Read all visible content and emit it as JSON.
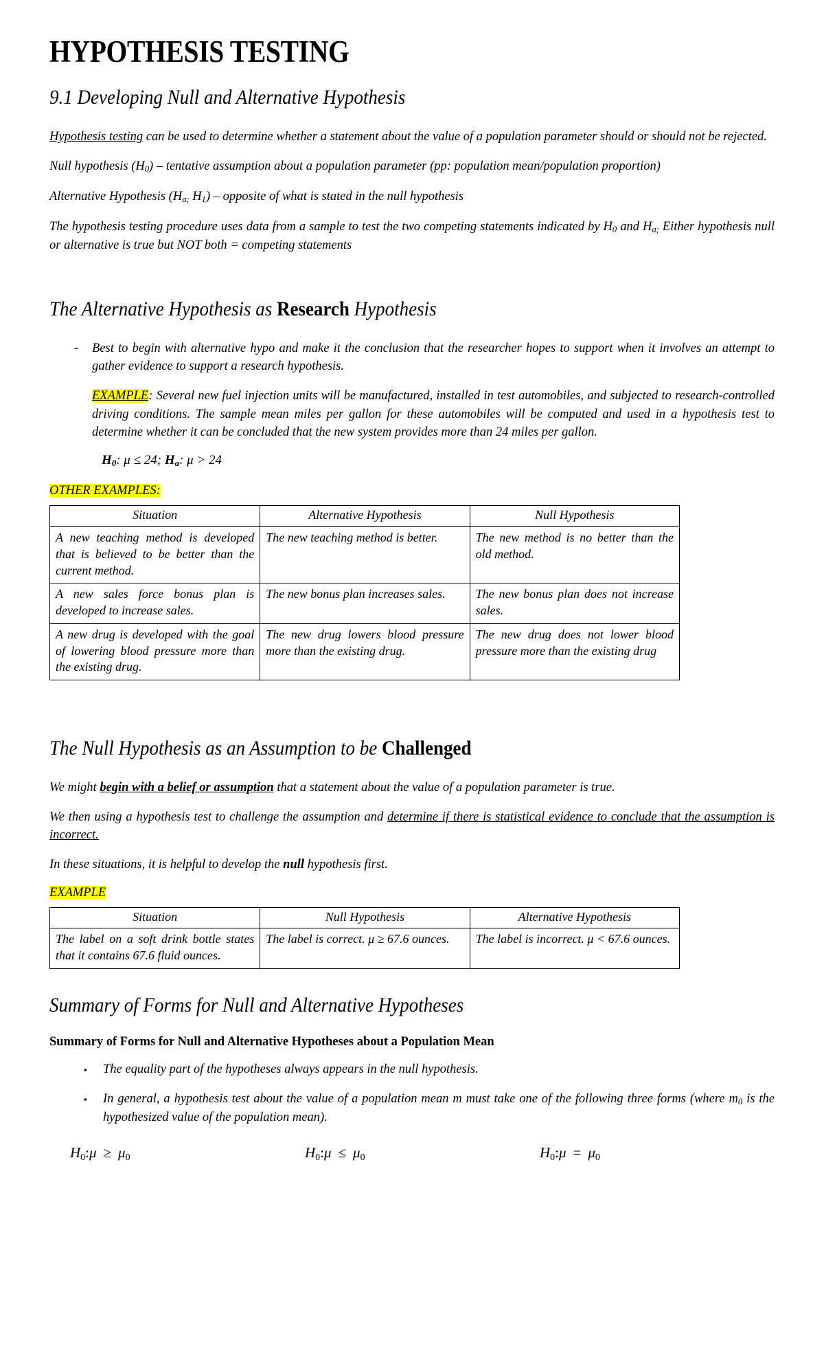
{
  "document": {
    "title": "HYPOTHESIS TESTING",
    "section_heading": "9.1 Developing Null and Alternative Hypothesis",
    "intro": {
      "p1_lead": "Hypothesis testing",
      "p1_rest": " can be used to determine whether a statement about the value of a population parameter should or should not be rejected.",
      "p2_a": "Null hypothesis (H",
      "p2_sub": "0",
      "p2_b": ") – tentative assumption about a population parameter (pp: population mean/population proportion)",
      "p3_a": "Alternative Hypothesis (H",
      "p3_sub1": "a;",
      "p3_mid": " H",
      "p3_sub2": "1",
      "p3_b": ") – opposite of what is stated in the null hypothesis",
      "p4_a": "The hypothesis testing procedure uses data from a sample to test the two competing statements indicated by H",
      "p4_sub1": "0",
      "p4_mid": " and H",
      "p4_sub2": "a;",
      "p4_b": " Either hypothesis null or alternative is true but NOT both = competing statements"
    },
    "research_section": {
      "heading_pre": "The Alternative Hypothesis as ",
      "heading_bold": "Research",
      "heading_post": " Hypothesis",
      "dash_marker": "-",
      "bullet": "Best to begin with alternative hypo and make it the conclusion that the researcher hopes to support when it involves an attempt to gather evidence to support a research hypothesis.",
      "example_label": "EXAMPLE",
      "example_text": ": Several new fuel injection units will be manufactured, installed in test automobiles, and subjected to research-controlled driving conditions. The sample mean miles per gallon for these automobiles will be computed and used in a hypothesis test to determine whether it can be concluded that the new system provides more than 24 miles per gallon.",
      "formula_h0_label": "H",
      "formula_h0_sub": "0",
      "formula_h0_body": ": μ ≤ 24; ",
      "formula_ha_label": "H",
      "formula_ha_sub": "a",
      "formula_ha_body": ": μ > 24",
      "other_examples_label": "OTHER EXAMPLES:"
    },
    "table1": {
      "headers": [
        "Situation",
        "Alternative Hypothesis",
        "Null Hypothesis"
      ],
      "rows": [
        [
          "A new teaching method is developed that is believed to be better than the current method.",
          "The new teaching method is better.",
          "The new method is no better than the old method."
        ],
        [
          "A new sales force bonus plan is developed to increase sales.",
          "The new bonus plan increases sales.",
          "The new bonus plan does not increase sales."
        ],
        [
          "A new drug is developed with the goal of lowering blood pressure more than the existing drug.",
          "The new drug lowers blood pressure more than the existing drug.",
          "The new drug does not lower blood pressure more than the existing drug"
        ]
      ]
    },
    "challenged_section": {
      "heading_pre": "The Null Hypothesis as an Assumption to be ",
      "heading_bold": "Challenged",
      "p1_a": "We might ",
      "p1_u": "begin with a belief or assumption",
      "p1_b": " that a statement about the value of a population parameter is true.",
      "p2_a": "We then using a hypothesis test to challenge the assumption and ",
      "p2_u": "determine if there is statistical evidence to conclude that the assumption is incorrect.",
      "p3_a": "In these situations, it is helpful to develop the ",
      "p3_bold": "null",
      "p3_b": " hypothesis first.",
      "example_label": "EXAMPLE"
    },
    "table2": {
      "headers": [
        "Situation",
        "Null Hypothesis",
        "Alternative Hypothesis"
      ],
      "rows": [
        [
          "The label on a soft drink bottle states that it contains 67.6 fluid ounces.",
          "The label is correct.    μ ≥ 67.6 ounces.",
          "The label is incorrect.    μ < 67.6 ounces."
        ]
      ]
    },
    "summary_section": {
      "heading": "Summary of Forms for Null and Alternative Hypotheses",
      "subheading": "Summary of Forms for Null and Alternative Hypotheses about a Population Mean",
      "square_marker": "▪",
      "bullet1": "The equality part of the hypotheses always appears in the null hypothesis.",
      "bullet2_a": "In general, a hypothesis test about the value of a population mean  m  must take one of the following three forms (where m",
      "bullet2_sub": "0",
      "bullet2_b": " is the hypothesized value of the population mean).",
      "formulas": [
        {
          "h": "H",
          "hsub": "0",
          "colon": ":",
          "mu": "μ",
          "op": "≥",
          "mu0": "μ",
          "mu0sub": "0"
        },
        {
          "h": "H",
          "hsub": "0",
          "colon": ":",
          "mu": "μ",
          "op": "≤",
          "mu0": "μ",
          "mu0sub": "0"
        },
        {
          "h": "H",
          "hsub": "0",
          "colon": ":",
          "mu": "μ",
          "op": "=",
          "mu0": "μ",
          "mu0sub": "0"
        }
      ]
    }
  }
}
